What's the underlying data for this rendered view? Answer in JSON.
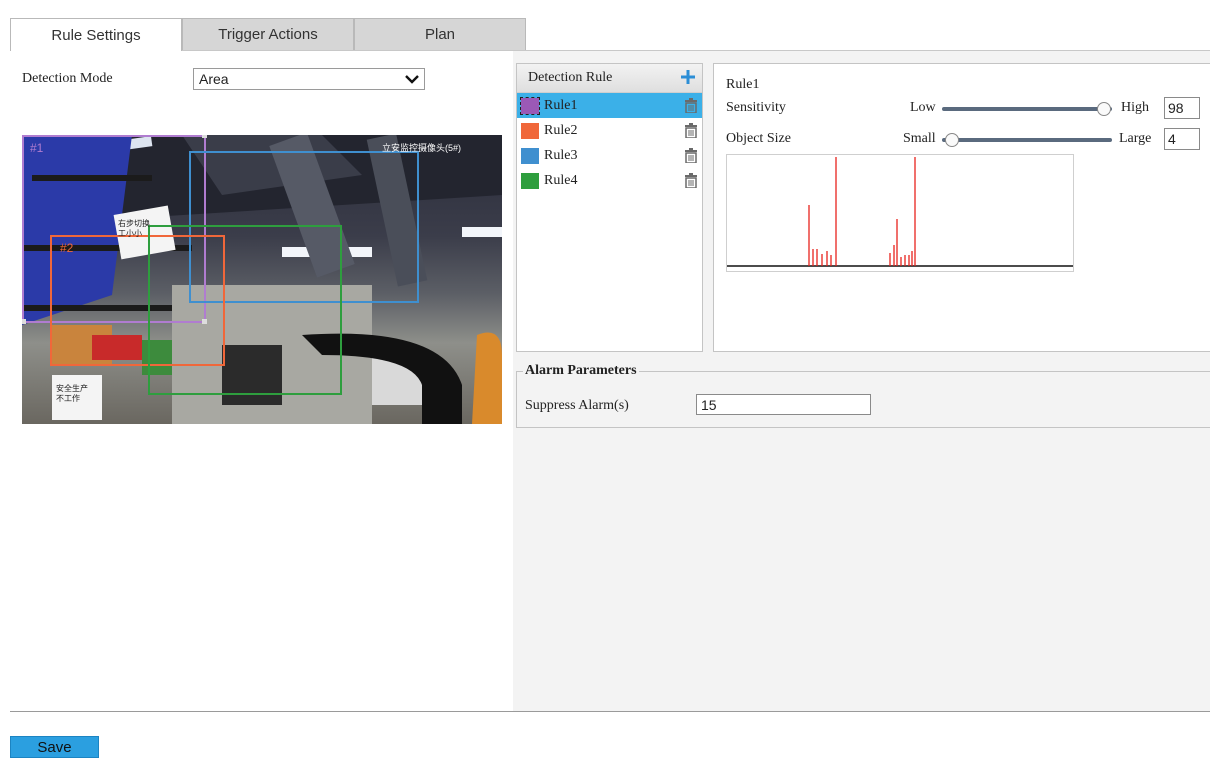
{
  "tabs": [
    {
      "label": "Rule Settings",
      "active": true
    },
    {
      "label": "Trigger Actions",
      "active": false
    },
    {
      "label": "Plan",
      "active": false
    }
  ],
  "detection": {
    "mode_label": "Detection Mode",
    "mode_value": "Area"
  },
  "video": {
    "overlay_text": "立安监控摄像头(5#)",
    "region_labels": [
      "#1",
      "#2"
    ],
    "sign_text_1": "右步切换\n工小小",
    "sign_text_2": "安全生产\n不工作"
  },
  "rules": {
    "header": "Detection Rule",
    "items": [
      {
        "label": "Rule1",
        "color": "#9b59b6",
        "selected": true
      },
      {
        "label": "Rule2",
        "color": "#f0673a",
        "selected": false
      },
      {
        "label": "Rule3",
        "color": "#3f8fcf",
        "selected": false
      },
      {
        "label": "Rule4",
        "color": "#2e9e3e",
        "selected": false
      }
    ]
  },
  "rule_detail": {
    "title": "Rule1",
    "sensitivity_label": "Sensitivity",
    "sensitivity_low": "Low",
    "sensitivity_high": "High",
    "sensitivity_value": "98",
    "object_size_label": "Object Size",
    "object_size_small": "Small",
    "object_size_large": "Large",
    "object_size_value": "4"
  },
  "alarm": {
    "legend": "Alarm Parameters",
    "suppress_label": "Suppress Alarm(s)",
    "suppress_value": "15"
  },
  "actions": {
    "save_label": "Save"
  },
  "colors": {
    "selected_row": "#3bb0e8",
    "save_button": "#2b9fe0",
    "graph_spikes": "#e8221c"
  }
}
